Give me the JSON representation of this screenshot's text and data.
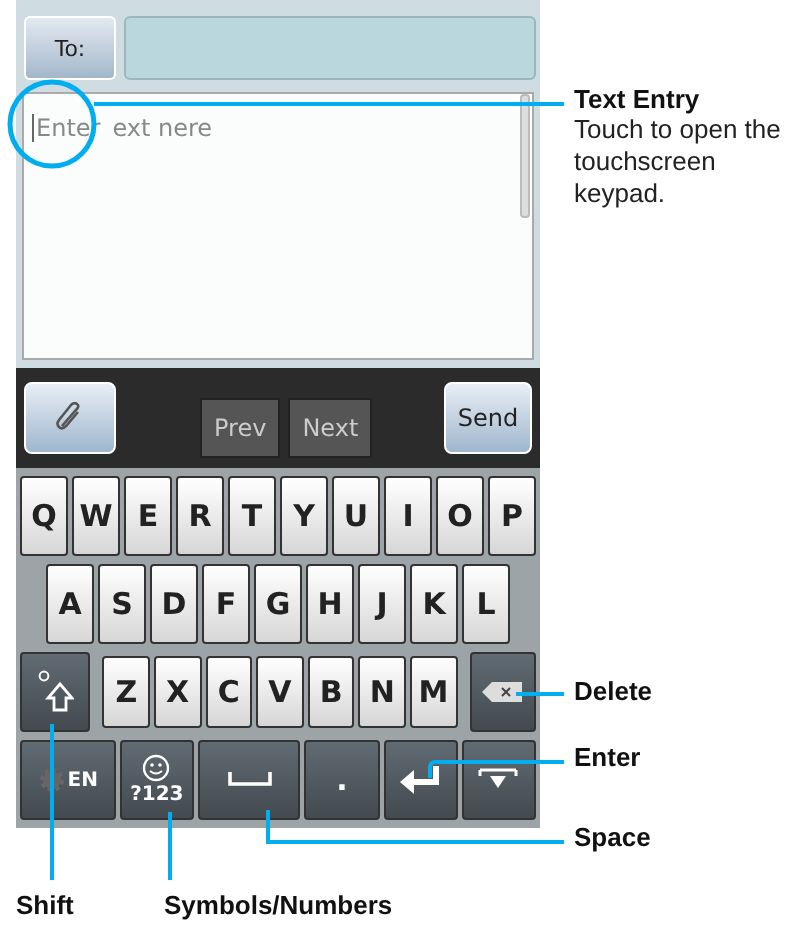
{
  "header": {
    "to_button": "To:"
  },
  "message": {
    "placeholder_start": "Enter",
    "placeholder_rest": "ext nere"
  },
  "toolbar": {
    "prev": "Prev",
    "next": "Next",
    "send": "Send"
  },
  "keyboard": {
    "rows": [
      [
        {
          "kind": "letter",
          "label": "Q"
        },
        {
          "kind": "letter",
          "label": "W"
        },
        {
          "kind": "letter",
          "label": "E"
        },
        {
          "kind": "letter",
          "label": "R"
        },
        {
          "kind": "letter",
          "label": "T"
        },
        {
          "kind": "letter",
          "label": "Y"
        },
        {
          "kind": "letter",
          "label": "U"
        },
        {
          "kind": "letter",
          "label": "I"
        },
        {
          "kind": "letter",
          "label": "O"
        },
        {
          "kind": "letter",
          "label": "P"
        }
      ],
      [
        {
          "kind": "letter",
          "label": "A"
        },
        {
          "kind": "letter",
          "label": "S"
        },
        {
          "kind": "letter",
          "label": "D"
        },
        {
          "kind": "letter",
          "label": "F"
        },
        {
          "kind": "letter",
          "label": "G"
        },
        {
          "kind": "letter",
          "label": "H"
        },
        {
          "kind": "letter",
          "label": "J"
        },
        {
          "kind": "letter",
          "label": "K"
        },
        {
          "kind": "letter",
          "label": "L"
        }
      ],
      [
        {
          "kind": "shift"
        },
        {
          "kind": "letter",
          "label": "Z"
        },
        {
          "kind": "letter",
          "label": "X"
        },
        {
          "kind": "letter",
          "label": "C"
        },
        {
          "kind": "letter",
          "label": "V"
        },
        {
          "kind": "letter",
          "label": "B"
        },
        {
          "kind": "letter",
          "label": "N"
        },
        {
          "kind": "letter",
          "label": "M"
        },
        {
          "kind": "delete"
        }
      ],
      [
        {
          "kind": "settings",
          "label": "EN"
        },
        {
          "kind": "symbols",
          "label": "?123"
        },
        {
          "kind": "space"
        },
        {
          "kind": "period",
          "label": "."
        },
        {
          "kind": "enter"
        },
        {
          "kind": "hide"
        }
      ]
    ]
  },
  "callouts": [
    {
      "title": "Text Entry",
      "text": "Touch to open the touchscreen keypad."
    },
    {
      "title": "Delete"
    },
    {
      "title": "Enter"
    },
    {
      "title": "Space"
    },
    {
      "title": "Shift"
    },
    {
      "title": "Symbols/Numbers"
    }
  ]
}
